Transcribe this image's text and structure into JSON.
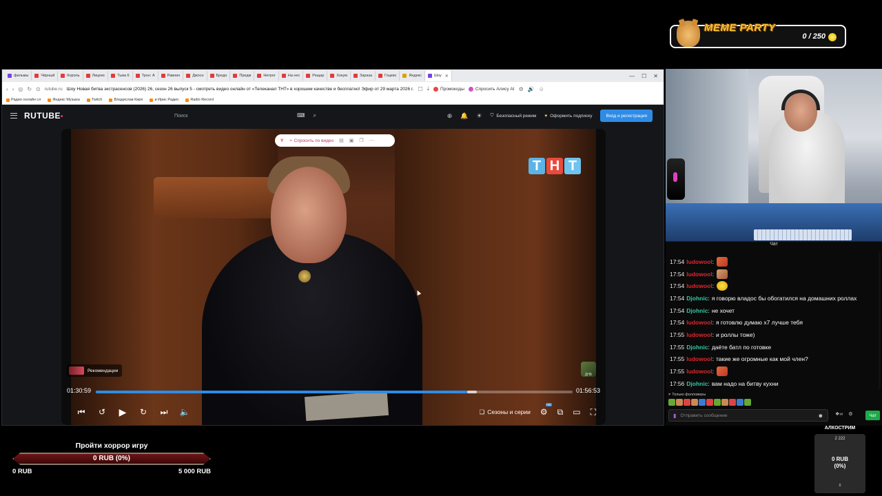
{
  "browser": {
    "tabs": [
      {
        "label": "фильмы",
        "active": false
      },
      {
        "label": "Чёрный",
        "active": false
      },
      {
        "label": "Король",
        "active": false
      },
      {
        "label": "Лицеис",
        "active": false
      },
      {
        "label": "Тьма 6",
        "active": false
      },
      {
        "label": "Трон: А",
        "active": false
      },
      {
        "label": "Равнин",
        "active": false
      },
      {
        "label": "Джосн",
        "active": false
      },
      {
        "label": "Бредо",
        "active": false
      },
      {
        "label": "Предм",
        "active": false
      },
      {
        "label": "Нетрог",
        "active": false
      },
      {
        "label": "На нес",
        "active": false
      },
      {
        "label": "Рещар",
        "active": false
      },
      {
        "label": "Хокум",
        "active": false
      },
      {
        "label": "Зараза",
        "active": false
      },
      {
        "label": "Гоцевс",
        "active": false
      },
      {
        "label": "Яндекс",
        "active": false
      },
      {
        "label": "Шоу",
        "active": true
      }
    ],
    "address": {
      "domain": "rutube.ru",
      "title": "Шоу Новая битва экстрасенсов (2026) 26, сезон 26 выпуск 5 - смотреть видео онлайн от «Телеканал ТНТ» в хорошем качестве и бесплатно! Эфир от 29 марта 2026 г.",
      "promo": "Промокоды",
      "alice": "Спросить Алису AI"
    },
    "bookmarks": [
      "Радио онлайн сл",
      "Яндекс Музыка",
      "Twitch",
      "Владислав Кирп",
      "и Ирис Радио",
      "Radio Record"
    ]
  },
  "rutube": {
    "logo": "RUTUBE",
    "search_placeholder": "Поиск",
    "safe_mode": "Безопасный режим",
    "subscribe": "Оформить подписку",
    "login": "Вход и регистрация"
  },
  "player": {
    "ask_video": "Спросить по видео",
    "channel_logo": [
      "Т",
      "Н",
      "Т"
    ],
    "recommendations": "Рекомендации",
    "current_time": "01:30:59",
    "total_time": "01:56:53",
    "progress": 0.7787,
    "seasons_label": "Сезоны и серии",
    "channel_badge": "ДНБ"
  },
  "chat": {
    "title": "Чат",
    "messages": [
      {
        "time": "17:54",
        "user": "ludowool",
        "color": "red",
        "text": "",
        "emote": "e1"
      },
      {
        "time": "17:54",
        "user": "ludowool",
        "color": "red",
        "text": "",
        "emote": "e2"
      },
      {
        "time": "17:54",
        "user": "ludowool",
        "color": "red",
        "text": "",
        "emote": "e3"
      },
      {
        "time": "17:54",
        "user": "Djohnic",
        "color": "green",
        "text": "я говорю владос бы обогатился на домашних роллах",
        "emote": ""
      },
      {
        "time": "17:54",
        "user": "Djohnic",
        "color": "green",
        "text": "не хочет",
        "emote": ""
      },
      {
        "time": "17:54",
        "user": "ludowool",
        "color": "red",
        "text": "я готовлю думаю х7 лучше тебя",
        "emote": ""
      },
      {
        "time": "17:55",
        "user": "ludowool",
        "color": "red",
        "text": "и роллы тоже)",
        "emote": ""
      },
      {
        "time": "17:55",
        "user": "Djohnic",
        "color": "green",
        "text": "даёте батл по готовке",
        "emote": ""
      },
      {
        "time": "17:55",
        "user": "ludowool",
        "color": "red",
        "text": "такие же огромные как мой член?",
        "emote": ""
      },
      {
        "time": "17:55",
        "user": "ludowool",
        "color": "red",
        "text": "",
        "emote": "e1"
      },
      {
        "time": "17:56",
        "user": "Djohnic",
        "color": "green",
        "text": "вам надо на битву кухни",
        "emote": ""
      }
    ],
    "followers_only": "Только фолловеры",
    "input_placeholder": "Отправить сообщение",
    "send_label": "Чат"
  },
  "meme_party": {
    "title": "MEME PARTY",
    "count": "0 / 250"
  },
  "goal": {
    "title": "Пройти хоррор игру",
    "progress_label": "0 RUB (0%)",
    "progress": 0,
    "min_label": "0 RUB",
    "max_label": "5 000 RUB"
  },
  "alcostream": {
    "title": "АЛКОСТРИМ",
    "goal": "2 222",
    "amount": "0 RUB",
    "percent": "(0%)",
    "zero": "0"
  }
}
